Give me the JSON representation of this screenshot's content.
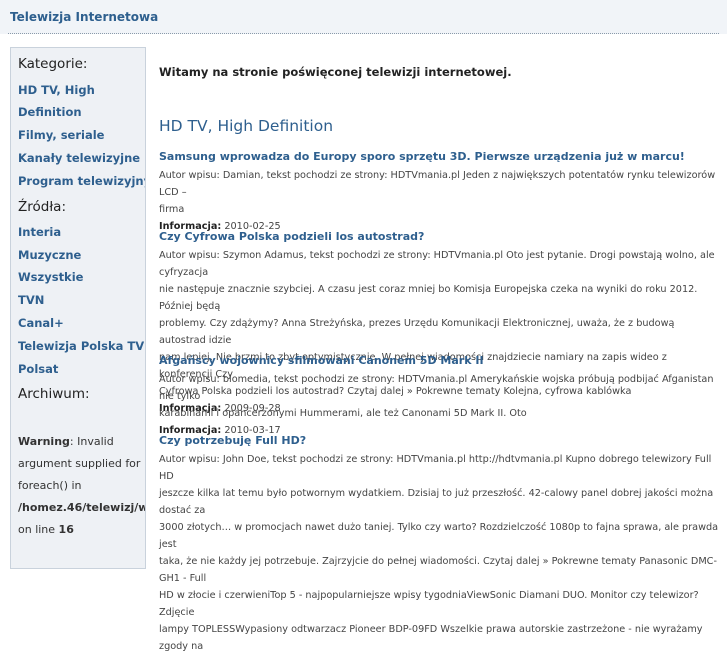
{
  "site": {
    "title": "Telewizja Internetowa"
  },
  "sidebar": {
    "categories_heading": "Kategorie:",
    "categories": [
      "HD TV, High",
      "Definition",
      "Filmy, seriale",
      "Kanały telewizyjne",
      "Program telewizyjny"
    ],
    "sources_heading": "Źródła:",
    "sources": [
      "Interia",
      "Muzyczne",
      "Wszystkie",
      "TVN",
      "Canal+",
      "Telewizja Polska TVP",
      "Polsat"
    ],
    "archive_heading": "Archiwum:",
    "warning": {
      "label": "Warning",
      "line1": ": Invalid",
      "line2": "argument supplied for",
      "line3": "foreach() in",
      "path": "/homez.46/telewizj/www/t",
      "line_prefix": "on line ",
      "line_number": "16"
    }
  },
  "main": {
    "welcome": "Witamy na stronie poświęconej telewizji internetowej.",
    "section_title": "HD TV, High Definition",
    "info_label": "Informacja:",
    "posts": [
      {
        "title": "Samsung wprowadza do Europy sporo sprzętu 3D. Pierwsze urządzenia już w marcu!",
        "lines": [
          "Autor wpisu: Damian, tekst pochodzi ze strony: HDTVmania.pl Jeden z największych potentatów rynku telewizorów LCD –",
          "firma"
        ],
        "date": "2010-02-25"
      },
      {
        "title": "Czy Cyfrowa Polska podzieli los autostrad?",
        "lines": [
          "Autor wpisu: Szymon Adamus, tekst pochodzi ze strony: HDTVmania.pl Oto jest pytanie. Drogi powstają wolno, ale cyfryzacja",
          "nie następuje znacznie szybciej. A czasu jest coraz mniej bo Komisja Europejska czeka na wyniki do roku 2012. Później będą",
          "problemy. Czy zdążymy? Anna Streżyńska, prezes Urzędu Komunikacji Elektronicznej, uważa, że z budową autostrad idzie",
          "nam lepiej. Nie brzmi to zbyt optymistycznie. W pełnej wiadomości znajdziecie namiary na zapis wideo z konferencji Czy",
          "Cyfrowa Polska podzieli los autostrad? Czytaj dalej » Pokrewne tematy Kolejna, cyfrowa kablówka"
        ],
        "date": "2009-09-28"
      },
      {
        "title": "Afgańscy wojownicy sfilmowani Canonem 5D Mark II",
        "lines": [
          "Autor wpisu: blomedia, tekst pochodzi ze strony: HDTVmania.pl Amerykańskie wojska próbują podbijać Afganistan nie tylko",
          "karabinami i opancerzonymi Hummerami, ale też Canonami 5D Mark II. Oto"
        ],
        "date": "2010-03-17"
      },
      {
        "title": "Czy potrzebuję Full HD?",
        "lines": [
          "Autor wpisu: John Doe, tekst pochodzi ze strony: HDTVmania.pl http://hdtvmania.pl Kupno dobrego telewizory Full HD",
          "jeszcze kilka lat temu było potwornym wydatkiem. Dzisiaj to już przeszłość. 42-calowy panel dobrej jakości można dostać za",
          "3000 złotych… w promocjach nawet dużo taniej. Tylko czy warto? Rozdzielczość 1080p to fajna sprawa, ale prawda jest",
          "taka, że nie każdy jej potrzebuje. Zajrzyjcie do pełnej wiadomości. Czytaj dalej » Pokrewne tematy Panasonic DMC-GH1 - Full",
          "HD w złocie i czerwieniTop 5 - najpopularniejsze wpisy tygodniaViewSonic Diamani DUO. Monitor czy telewizor?Zdjęcie",
          "lampy TOPLESSWypasiony odtwarzacz Pioneer BDP-09FD Wszelkie prawa autorskie zastrzeżone - nie wyrażamy zgody na"
        ],
        "date": ""
      }
    ]
  }
}
